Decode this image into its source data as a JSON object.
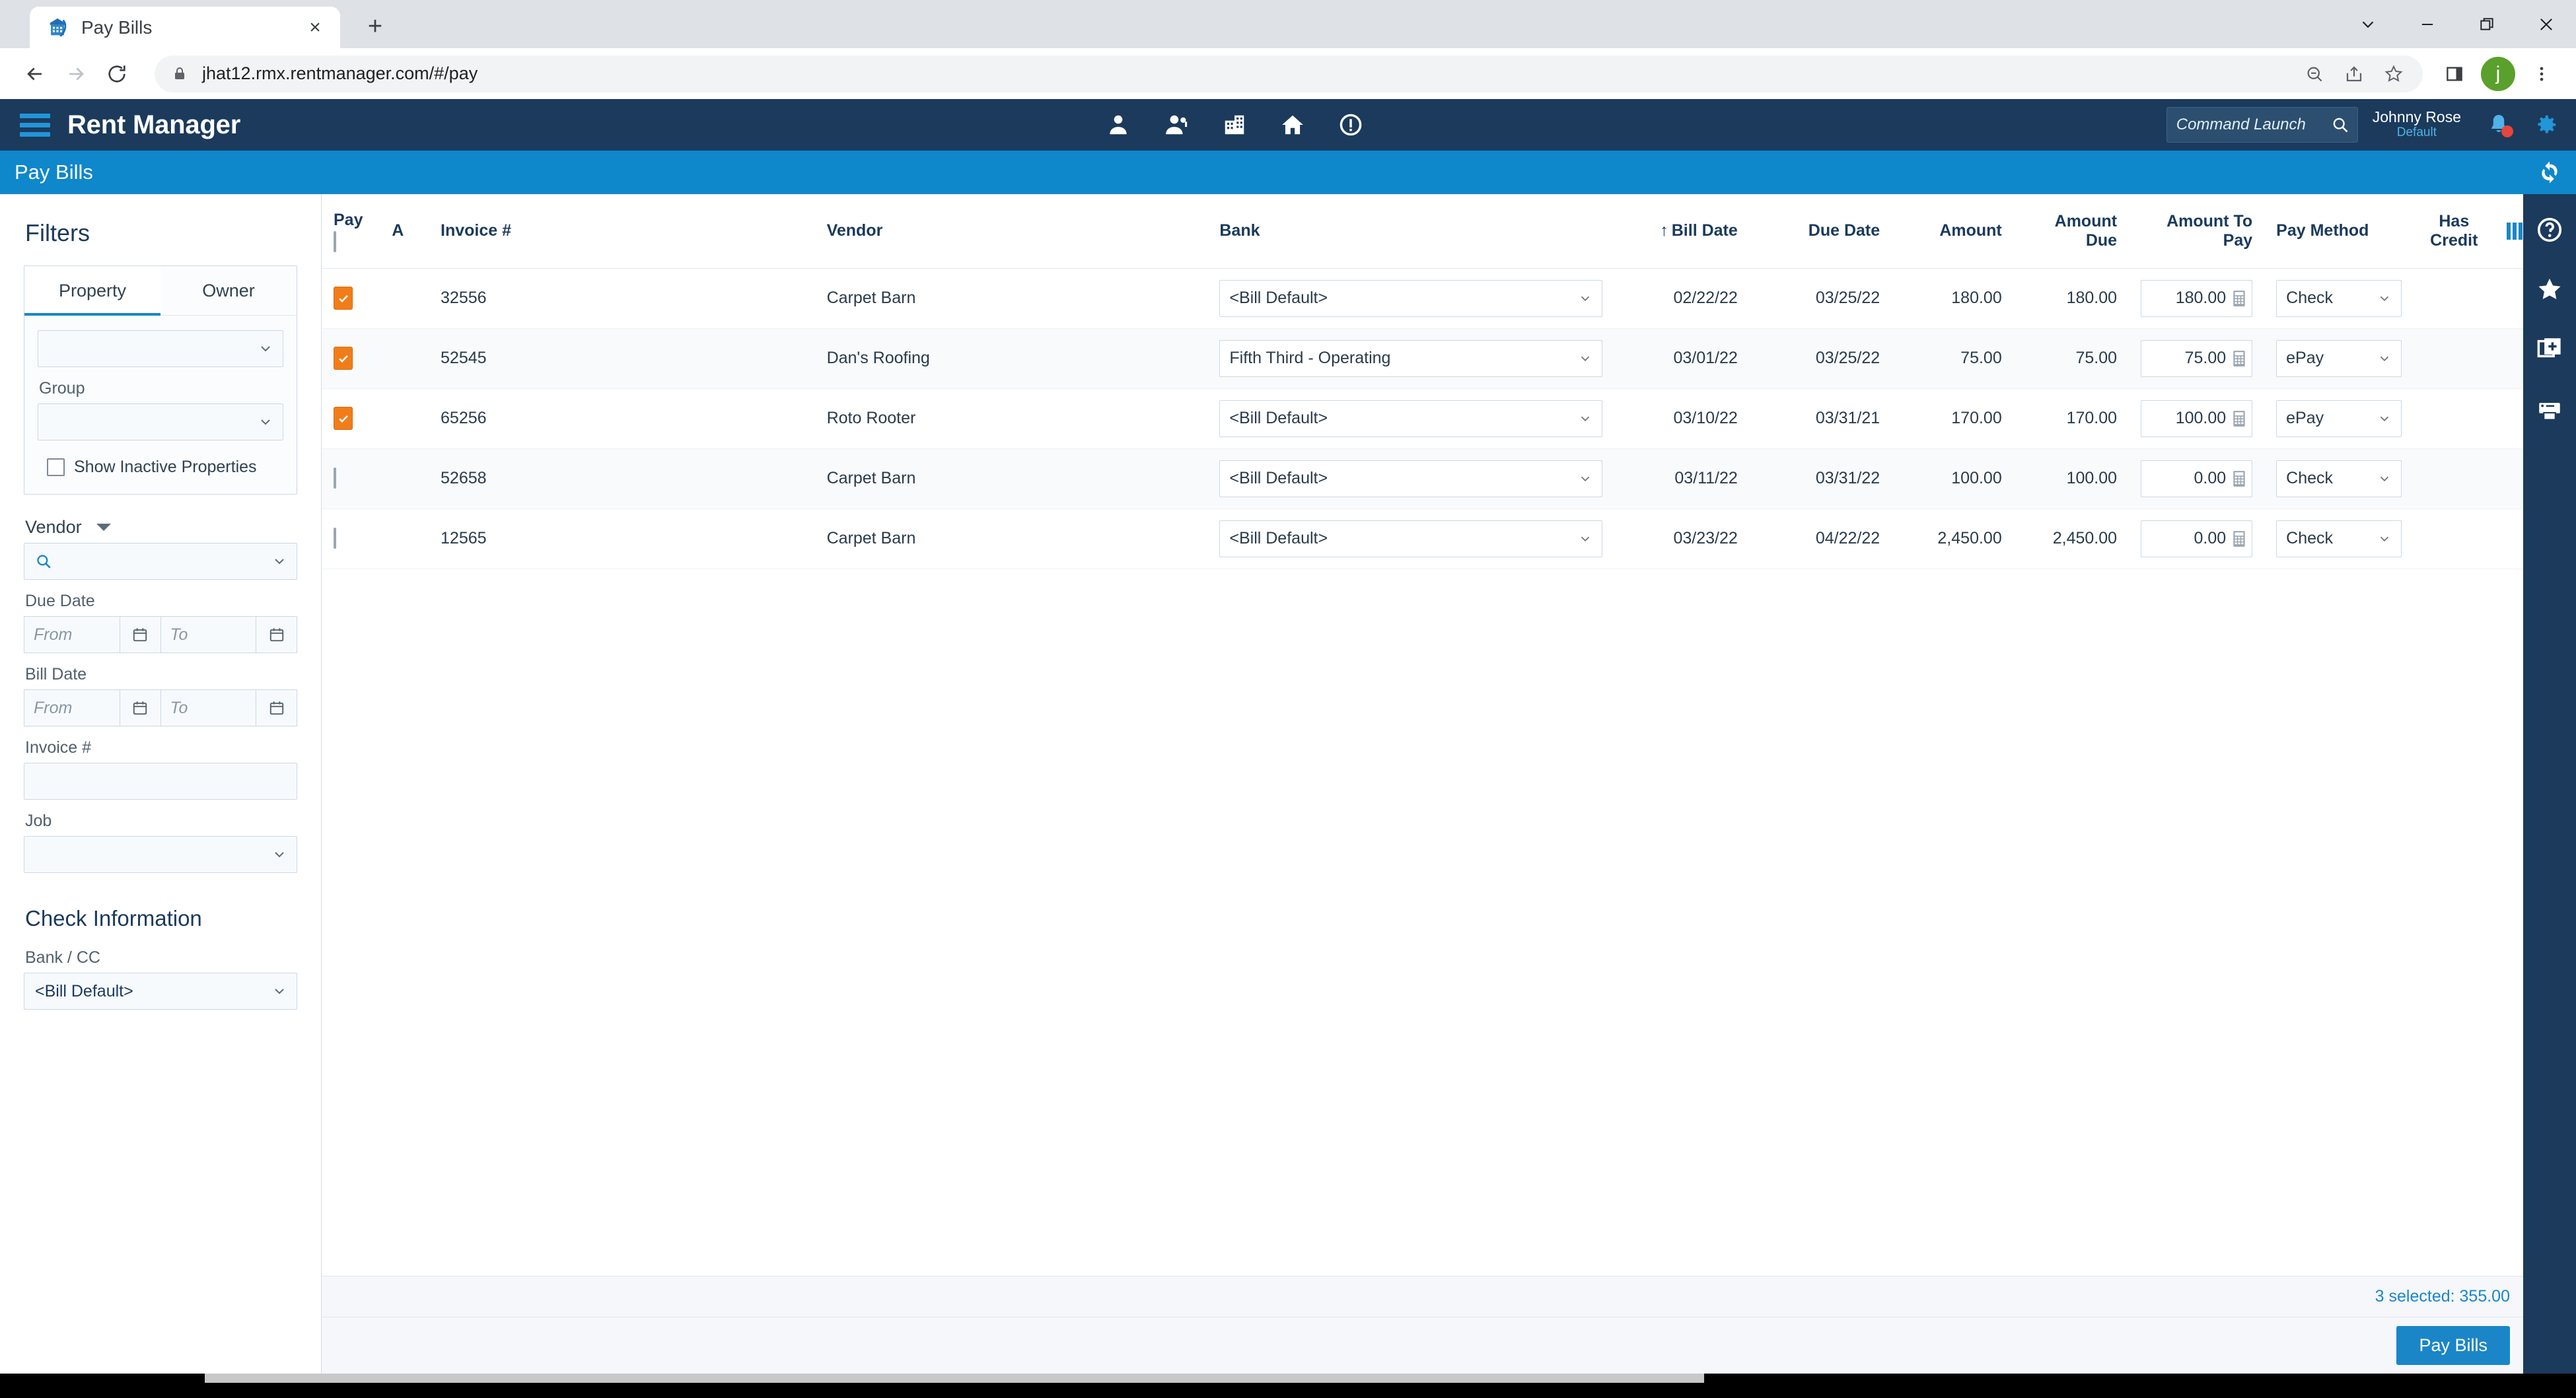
{
  "browser": {
    "tab": {
      "title": "Pay Bills",
      "favicon": "rentmanager-favicon",
      "close_label": "×"
    },
    "new_tab_label": "+",
    "window_controls": [
      "chevron-down",
      "minimize",
      "restore",
      "close"
    ],
    "nav": {
      "back": "←",
      "forward": "→",
      "reload": "⟳"
    },
    "url": "jhat12.rmx.rentmanager.com/#/pay",
    "omnibox_actions": [
      "zoom-out-icon",
      "share-icon",
      "bookmark-star-icon"
    ],
    "toolbar_right": [
      "side-panel-icon",
      "profile-avatar",
      "chrome-menu-icon"
    ],
    "profile_initial": "j"
  },
  "app": {
    "logo": "Rent Manager",
    "header_icons": [
      "tenant-icon",
      "prospect-icon",
      "property-icon",
      "home-icon",
      "info-icon"
    ],
    "command_launch_placeholder": "Command Launch",
    "user": {
      "name": "Johnny Rose",
      "role": "Default"
    },
    "notification_badge": true,
    "subbar_title": "Pay Bills",
    "refresh_icon": "refresh-icon"
  },
  "sidebar": {
    "title": "Filters",
    "tabs": [
      {
        "label": "Property",
        "active": true
      },
      {
        "label": "Owner",
        "active": false
      }
    ],
    "property_select": {
      "value": "",
      "placeholder": ""
    },
    "group_label": "Group",
    "group_select": {
      "value": "",
      "placeholder": ""
    },
    "show_inactive": {
      "label": "Show Inactive Properties",
      "checked": false
    },
    "vendor_label": "Vendor",
    "vendor_search": {
      "value": "",
      "placeholder": ""
    },
    "due_date_label": "Due Date",
    "bill_date_label": "Bill Date",
    "date_from_placeholder": "From",
    "date_to_placeholder": "To",
    "invoice_label": "Invoice #",
    "invoice_value": "",
    "job_label": "Job",
    "job_value": "",
    "check_info_title": "Check Information",
    "bank_cc_label": "Bank / CC",
    "bank_cc_value": "<Bill Default>"
  },
  "grid": {
    "columns": {
      "pay": "Pay",
      "a": "A",
      "invoice": "Invoice #",
      "vendor": "Vendor",
      "bank": "Bank",
      "bill_date": "Bill Date",
      "bill_date_sort": "↑",
      "due_date": "Due Date",
      "amount": "Amount",
      "amount_due": "Amount\nDue",
      "amount_due_l1": "Amount",
      "amount_due_l2": "Due",
      "amount_to_pay_l1": "Amount To",
      "amount_to_pay_l2": "Pay",
      "pay_method": "Pay Method",
      "has_credit_l1": "Has",
      "has_credit_l2": "Credit",
      "columns_icon": "column-chooser-icon"
    },
    "header_checkbox_checked": false,
    "rows": [
      {
        "pay": true,
        "a": "",
        "invoice": "32556",
        "vendor": "Carpet Barn",
        "bank": "<Bill Default>",
        "bill_date": "02/22/22",
        "due_date": "03/25/22",
        "amount": "180.00",
        "amount_due": "180.00",
        "amount_to_pay": "180.00",
        "pay_method": "Check",
        "has_credit": ""
      },
      {
        "pay": true,
        "a": "",
        "invoice": "52545",
        "vendor": "Dan's Roofing",
        "bank": "Fifth Third - Operating",
        "bill_date": "03/01/22",
        "due_date": "03/25/22",
        "amount": "75.00",
        "amount_due": "75.00",
        "amount_to_pay": "75.00",
        "pay_method": "ePay",
        "has_credit": ""
      },
      {
        "pay": true,
        "a": "",
        "invoice": "65256",
        "vendor": "Roto Rooter",
        "bank": "<Bill Default>",
        "bill_date": "03/10/22",
        "due_date": "03/31/21",
        "amount": "170.00",
        "amount_due": "170.00",
        "amount_to_pay": "100.00",
        "pay_method": "ePay",
        "has_credit": ""
      },
      {
        "pay": false,
        "a": "",
        "invoice": "52658",
        "vendor": "Carpet Barn",
        "bank": "<Bill Default>",
        "bill_date": "03/11/22",
        "due_date": "03/31/22",
        "amount": "100.00",
        "amount_due": "100.00",
        "amount_to_pay": "0.00",
        "pay_method": "Check",
        "has_credit": ""
      },
      {
        "pay": false,
        "a": "",
        "invoice": "12565",
        "vendor": "Carpet Barn",
        "bank": "<Bill Default>",
        "bill_date": "03/23/22",
        "due_date": "04/22/22",
        "amount": "2,450.00",
        "amount_due": "2,450.00",
        "amount_to_pay": "0.00",
        "pay_method": "Check",
        "has_credit": ""
      }
    ]
  },
  "footer": {
    "summary": "3 selected:  355.00",
    "pay_bills_button": "Pay Bills"
  },
  "right_rail": {
    "icons": [
      "help-icon",
      "favorite-star-icon",
      "add-page-icon",
      "print-icon"
    ]
  },
  "colors": {
    "header_navy": "#1b3a5c",
    "subbar_blue": "#0f87cb",
    "accent_blue": "#1a86c8",
    "checkbox_orange": "#f07d1a",
    "avatar_green": "#5aa02c",
    "badge_red": "#e8453c"
  }
}
